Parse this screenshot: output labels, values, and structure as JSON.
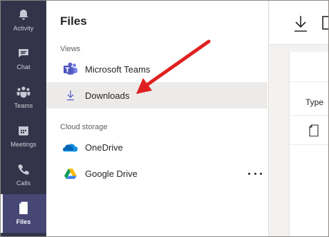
{
  "appbar": {
    "items": [
      {
        "label": "Activity",
        "icon": "bell-icon"
      },
      {
        "label": "Chat",
        "icon": "chat-icon"
      },
      {
        "label": "Teams",
        "icon": "teams-icon"
      },
      {
        "label": "Meetings",
        "icon": "calendar-icon"
      },
      {
        "label": "Calls",
        "icon": "phone-icon"
      },
      {
        "label": "Files",
        "icon": "file-icon",
        "active": true
      }
    ]
  },
  "files_pane": {
    "title": "Files",
    "views_label": "Views",
    "views": [
      {
        "label": "Microsoft Teams",
        "icon": "microsoft-teams-icon"
      },
      {
        "label": "Downloads",
        "icon": "download-icon",
        "selected": true
      }
    ],
    "cloud_label": "Cloud storage",
    "cloud": [
      {
        "label": "OneDrive",
        "icon": "onedrive-icon"
      },
      {
        "label": "Google Drive",
        "icon": "google-drive-icon"
      }
    ]
  },
  "content": {
    "column_type": "Type"
  },
  "colors": {
    "appbar_bg": "#33344a",
    "appbar_active": "#464775",
    "selected_bg": "#edebe9",
    "teams_purple": "#5b5fc7",
    "annotation_arrow": "#e02020"
  }
}
